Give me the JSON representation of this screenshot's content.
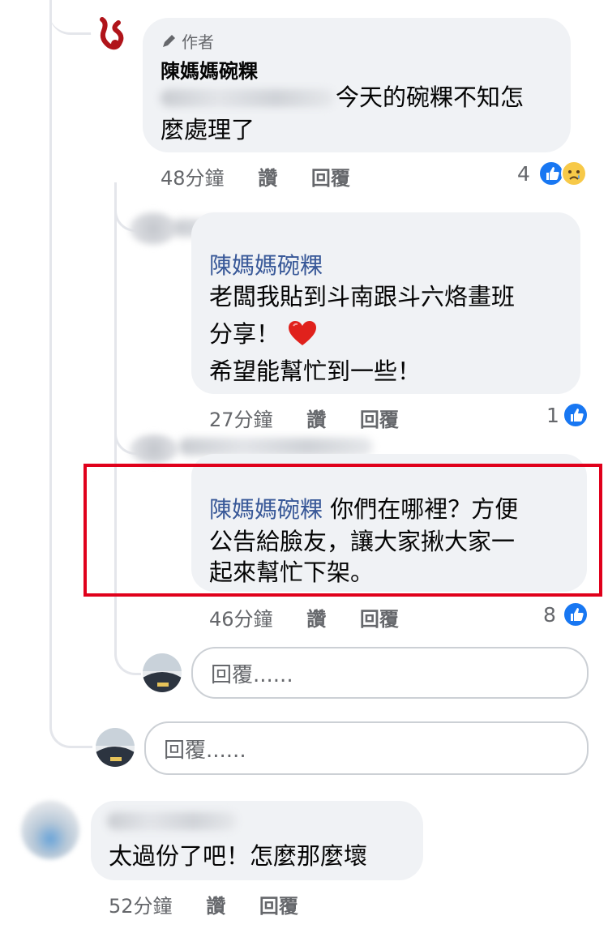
{
  "comment1": {
    "author_badge": "作者",
    "author_name": "陳媽媽碗粿",
    "text_line1": "今天的碗粿不知怎",
    "text_line2": "麼處理了",
    "time": "48分鐘",
    "like_action": "讚",
    "reply_action": "回覆",
    "reaction_count": "4"
  },
  "reply1": {
    "mention": "陳媽媽碗粿",
    "text_line1": "老闆我貼到斗南跟斗六烙畫班",
    "text_line2": "分享！",
    "text_line3": "希望能幫忙到一些！",
    "time": "27分鐘",
    "like_action": "讚",
    "reply_action": "回覆",
    "reaction_count": "1"
  },
  "reply2": {
    "mention": "陳媽媽碗粿",
    "text_line1": "你們在哪裡？方便",
    "text_line2": "公告給臉友，讓大家揪大家一",
    "text_line3": "起來幫忙下架。",
    "time": "46分鐘",
    "like_action": "讚",
    "reply_action": "回覆",
    "reaction_count": "8"
  },
  "reply_input_nested": {
    "placeholder": "回覆......"
  },
  "reply_input_thread": {
    "placeholder": "回覆......"
  },
  "comment2": {
    "text": "太過份了吧！怎麼那麼壞",
    "time": "52分鐘",
    "like_action": "讚",
    "reply_action": "回覆"
  },
  "colors": {
    "like_blue": "#1877f2",
    "mention_blue": "#385898",
    "highlight_red": "#e0001b",
    "bubble_gray": "#f0f2f5"
  }
}
